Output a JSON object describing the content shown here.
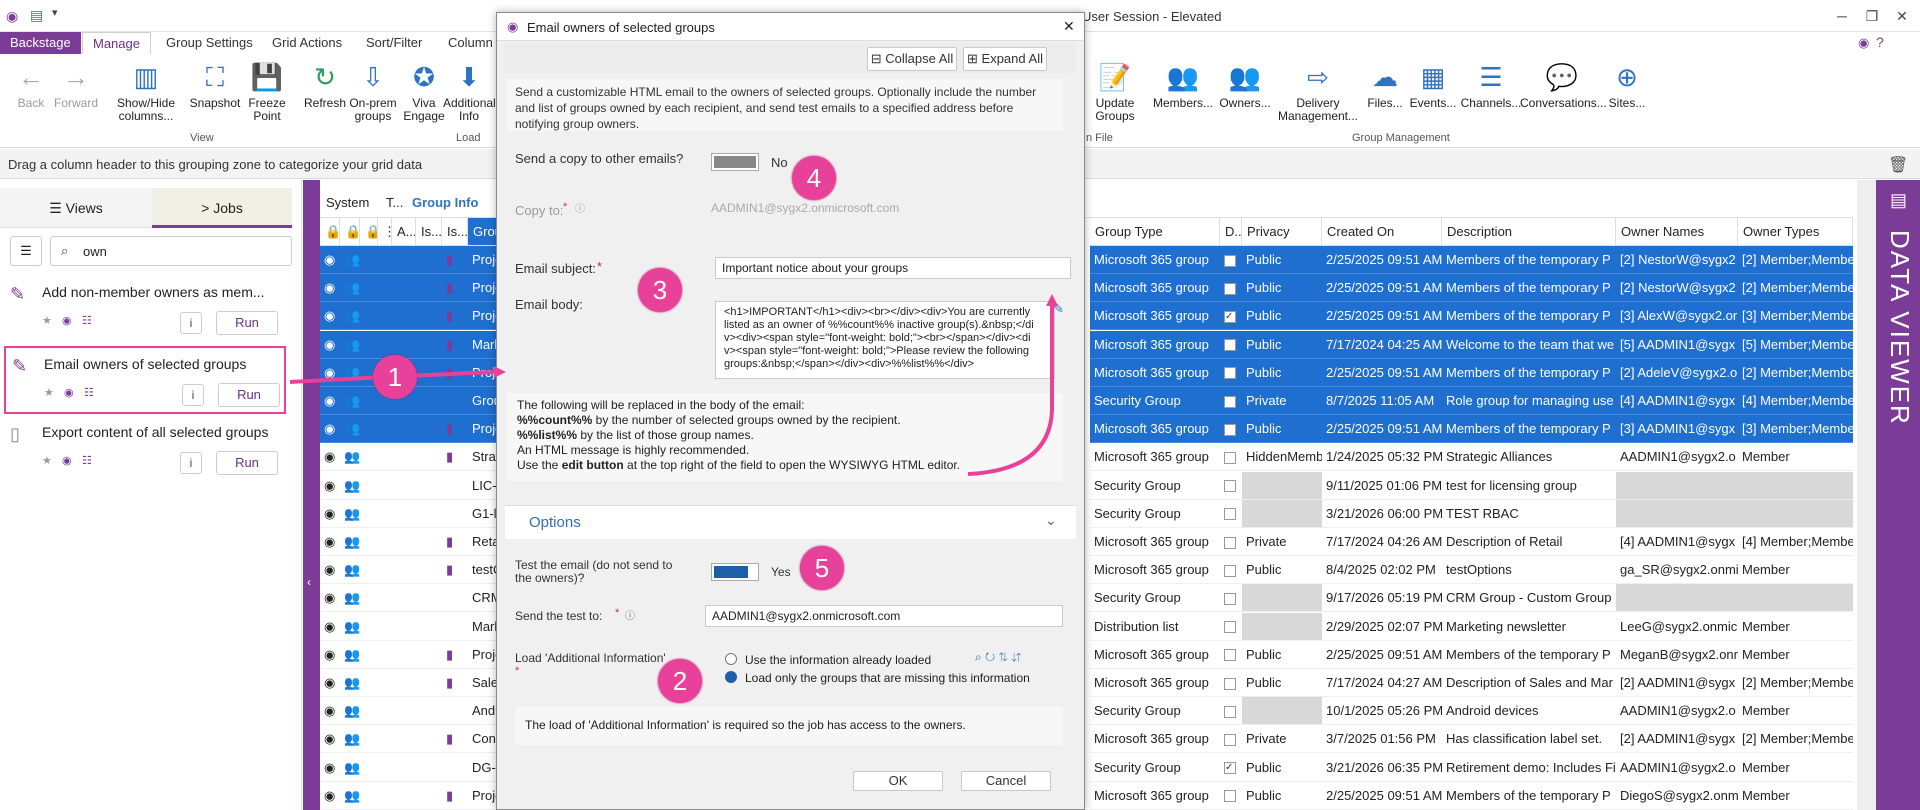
{
  "titlebar": {
    "title": "User Session - Elevated"
  },
  "tabs": {
    "backstage": "Backstage",
    "manage": "Manage",
    "group_settings": "Group Settings",
    "grid_actions": "Grid Actions",
    "sort_filter": "Sort/Filter",
    "column": "Column"
  },
  "ribbon": {
    "back": "Back",
    "forward": "Forward",
    "show_hide": "Show/Hide columns...",
    "snapshot": "Snapshot",
    "freeze": "Freeze Point",
    "refresh": "Refresh",
    "onprem": "On-prem groups",
    "viva": "Viva Engage",
    "addinfo": "Additional Info",
    "view_group": "View",
    "load_group": "Load",
    "file_group": "n File",
    "gm_group": "Group Management",
    "update_groups": "Update Groups",
    "members": "Members...",
    "owners": "Owners...",
    "delivery": "Delivery Management...",
    "files": "Files...",
    "events": "Events...",
    "channels": "Channels...",
    "conversations": "Conversations...",
    "sites": "Sites..."
  },
  "grouping_zone": "Drag a column header to this grouping zone to categorize your grid data",
  "left": {
    "views_tab": "Views",
    "jobs_tab": "Jobs",
    "search_value": "own",
    "jobs": [
      {
        "title": "Add non-member owners as mem...",
        "run": "Run"
      },
      {
        "title": "Email owners of selected groups",
        "run": "Run"
      },
      {
        "title": "Export content of all selected groups",
        "run": "Run"
      }
    ]
  },
  "grid": {
    "bands": {
      "system": "System",
      "t": "T...",
      "group_info": "Group Info"
    },
    "headers": {
      "a": "A...",
      "is1": "Is...",
      "is2": "Is...",
      "group": "Group",
      "group_type": "Group Type",
      "d": "D...",
      "privacy": "Privacy",
      "created_on": "Created On",
      "description": "Description",
      "owner_names": "Owner Names",
      "owner_types": "Owner Types"
    },
    "rows": [
      {
        "name": "Projec",
        "type": "Microsoft 365 group",
        "dyn": false,
        "privacy": "Public",
        "created": "2/25/2025 09:51 AM",
        "desc": "Members of the temporary P",
        "owners": "[2] NestorW@sygx2",
        "otypes": "[2] Member;Membe",
        "sel": true
      },
      {
        "name": "Projec",
        "type": "Microsoft 365 group",
        "dyn": false,
        "privacy": "Public",
        "created": "2/25/2025 09:51 AM",
        "desc": "Members of the temporary P",
        "owners": "[2] NestorW@sygx2",
        "otypes": "[2] Member;Membe",
        "sel": true
      },
      {
        "name": "Projec",
        "type": "Microsoft 365 group",
        "dyn": true,
        "privacy": "Public",
        "created": "2/25/2025 09:51 AM",
        "desc": "Members of the temporary P",
        "owners": "[3] AlexW@sygx2.or",
        "otypes": "[3] Member;Membe",
        "sel": true
      },
      {
        "name": "Mark",
        "type": "Microsoft 365 group",
        "dyn": false,
        "privacy": "Public",
        "created": "7/17/2024 04:25 AM",
        "desc": "Welcome to the team that we",
        "owners": "[5] AADMIN1@sygx",
        "otypes": "[5] Member;Membe",
        "sel": true
      },
      {
        "name": "Projec",
        "type": "Microsoft 365 group",
        "dyn": false,
        "privacy": "Public",
        "created": "2/25/2025 09:51 AM",
        "desc": "Members of the temporary P",
        "owners": "[2] AdeleV@sygx2.o",
        "otypes": "[2] Member;Membe",
        "sel": true
      },
      {
        "name": "Group",
        "type": "Security Group",
        "dyn": false,
        "privacy": "Private",
        "created": "8/7/2025 11:05 AM",
        "desc": "Role group for managing use",
        "owners": "[4] AADMIN1@sygx",
        "otypes": "[4] Member;Membe",
        "sel": true
      },
      {
        "name": "Projec",
        "type": "Microsoft 365 group",
        "dyn": false,
        "privacy": "Public",
        "created": "2/25/2025 09:51 AM",
        "desc": "Members of the temporary P",
        "owners": "[3] AADMIN1@sygx",
        "otypes": "[3] Member;Membe",
        "sel": true
      },
      {
        "name": "Strate",
        "type": "Microsoft 365 group",
        "dyn": false,
        "privacy": "HiddenMemb",
        "created": "1/24/2025 05:32 PM",
        "desc": "Strategic Alliances",
        "owners": "AADMIN1@sygx2.o",
        "otypes": "Member",
        "sel": false
      },
      {
        "name": "LIC-cc",
        "type": "Security Group",
        "dyn": false,
        "privacy": "",
        "created": "9/11/2025 01:06 PM",
        "desc": "test for licensing group",
        "owners": "",
        "otypes": "",
        "sel": false
      },
      {
        "name": "G1-loc",
        "type": "Security Group",
        "dyn": false,
        "privacy": "",
        "created": "3/21/2026 06:00 PM",
        "desc": "TEST RBAC",
        "owners": "",
        "otypes": "",
        "sel": false
      },
      {
        "name": "Retail",
        "type": "Microsoft 365 group",
        "dyn": false,
        "privacy": "Private",
        "created": "7/17/2024 04:26 AM",
        "desc": "Description of Retail",
        "owners": "[4] AADMIN1@sygx",
        "otypes": "[4] Member;Membe",
        "sel": false
      },
      {
        "name": "testOp",
        "type": "Microsoft 365 group",
        "dyn": false,
        "privacy": "Public",
        "created": "8/4/2025 02:02 PM",
        "desc": "testOptions",
        "owners": "ga_SR@sygx2.onmi",
        "otypes": "Member",
        "sel": false
      },
      {
        "name": "CRMT",
        "type": "Security Group",
        "dyn": false,
        "privacy": "",
        "created": "9/17/2026 05:19 PM",
        "desc": "CRM Group - Custom Group",
        "owners": "",
        "otypes": "",
        "sel": false
      },
      {
        "name": "Marke",
        "type": "Distribution list",
        "dyn": false,
        "privacy": "",
        "created": "2/29/2025 02:07 PM",
        "desc": "Marketing newsletter",
        "owners": "LeeG@sygx2.onmic",
        "otypes": "Member",
        "sel": false
      },
      {
        "name": "Projec",
        "type": "Microsoft 365 group",
        "dyn": false,
        "privacy": "Public",
        "created": "2/25/2025 09:51 AM",
        "desc": "Members of the temporary P",
        "owners": "MeganB@sygx2.onr",
        "otypes": "Member",
        "sel": false
      },
      {
        "name": "Sales",
        "type": "Microsoft 365 group",
        "dyn": false,
        "privacy": "Public",
        "created": "7/17/2024 04:27 AM",
        "desc": "Description of Sales and Mar",
        "owners": "[2] AADMIN1@sygx",
        "otypes": "[2] Member;Membe",
        "sel": false
      },
      {
        "name": "Andro",
        "type": "Security Group",
        "dyn": false,
        "privacy": "",
        "created": "10/1/2025 05:26 PM",
        "desc": "Android devices",
        "owners": "AADMIN1@sygx2.o",
        "otypes": "Member",
        "sel": false
      },
      {
        "name": "Confic",
        "type": "Microsoft 365 group",
        "dyn": false,
        "privacy": "Private",
        "created": "3/7/2025 01:56 PM",
        "desc": "Has classification label set.",
        "owners": "[2] AADMIN1@sygx",
        "otypes": "[2] Member;Membe",
        "sel": false
      },
      {
        "name": "DG-De",
        "type": "Security Group",
        "dyn": true,
        "privacy": "Public",
        "created": "3/21/2026 06:35 PM",
        "desc": "Retirement demo: Includes Fi",
        "owners": "AADMIN1@sygx2.o",
        "otypes": "Member",
        "sel": false
      },
      {
        "name": "Projec",
        "type": "Microsoft 365 group",
        "dyn": false,
        "privacy": "Public",
        "created": "2/25/2025 09:51 AM",
        "desc": "Members of the temporary P",
        "owners": "DiegoS@sygx2.onm",
        "otypes": "Member",
        "sel": false
      }
    ]
  },
  "dataviewer": "DATA VIEWER",
  "dialog": {
    "title": "Email owners of selected groups",
    "collapse_all": "Collapse All",
    "expand_all": "Expand All",
    "intro": "Send a customizable HTML email to the owners of selected groups. Optionally include the number and list of groups owned by each recipient, and send test emails to a specified address before notifying group owners.",
    "send_copy_label": "Send a copy to other emails?",
    "send_copy_value": "No",
    "copy_to_label": "Copy to:",
    "copy_to_value": "AADMIN1@sygx2.onmicrosoft.com",
    "subject_label": "Email subject:",
    "subject_value": "Important notice about your groups",
    "body_label": "Email body:",
    "body_value": "<h1>IMPORTANT</h1><div><br></div><div>You are currently listed as an owner of %%count%% inactive group(s).&nbsp;</div><div><span style=\"font-weight: bold;\"><br></span></div><div><span style=\"font-weight: bold;\">Please review the following groups:&nbsp;</span></div><div>%%list%%</div>",
    "help_line1": "The following will be replaced in the body of the email:",
    "help_count_token": "%%count%%",
    "help_count_text": " by the number of selected groups owned by the recipient.",
    "help_list_token": "%%list%%",
    "help_list_text": " by the list of those group names.",
    "help_line4": "An HTML message is highly recommended.",
    "help_line5a": "Use the ",
    "help_line5b": "edit button",
    "help_line5c": " at the top right of the field to open the WYSIWYG HTML editor.",
    "options_title": "Options",
    "test_label": "Test the email (do not send to the owners)?",
    "test_value": "Yes",
    "send_test_label": "Send the test to:",
    "send_test_value": "AADMIN1@sygx2.onmicrosoft.com",
    "load_label": "Load 'Additional Information'",
    "load_opt1": "Use the information already loaded",
    "load_opt2": "Load only the groups that are missing this information",
    "load_note": "The load of 'Additional Information' is required so the job has access to the owners.",
    "ok": "OK",
    "cancel": "Cancel"
  },
  "badges": [
    "1",
    "2",
    "3",
    "4",
    "5"
  ],
  "colors": {
    "accent": "#7a3c96",
    "selection": "#1e6fd0",
    "badge": "#e8419a"
  }
}
